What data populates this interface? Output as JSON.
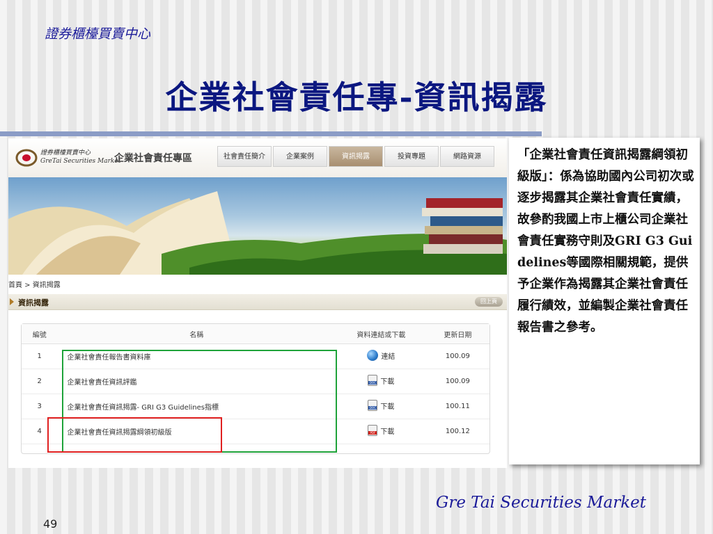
{
  "slide": {
    "org_name": "證券櫃檯買賣中心",
    "title": "企業社會責任專-資訊揭露",
    "footer_brand": "Gre Tai Securities Market",
    "page_number": "49",
    "note_text": "「企業社會責任資訊揭露綱領初級版」：係為協助國內公司初次或逐步揭露其企業社會責任實績，故參酌我國上市上櫃公司企業社會責任實務守則及GRI G3 Guidelines等國際相關規範，提供予企業作為揭露其企業社會責任履行績效，並編製企業社會責任報告書之參考。"
  },
  "site": {
    "logo_text_line1": "證券櫃檯買賣中心",
    "logo_text_line2": "GreTai Securities Market",
    "zone_title": "企業社會責任專區",
    "nav": [
      "社會責任簡介",
      "企業案例",
      "資訊揭露",
      "投資專題",
      "網路資源"
    ],
    "active_nav_index": 2,
    "breadcrumb": "首頁 > 資訊揭露",
    "section_title": "資訊揭露",
    "back_label": "回上頁",
    "table": {
      "headers": [
        "編號",
        "名稱",
        "資料連結或下載",
        "更新日期"
      ],
      "rows": [
        {
          "no": "1",
          "name": "企業社會責任報告書資料庫",
          "action": "連結",
          "icon": "globe-icon",
          "date": "100.09"
        },
        {
          "no": "2",
          "name": "企業社會責任資訊評鑑",
          "action": "下載",
          "icon": "doc-icon",
          "date": "100.09"
        },
        {
          "no": "3",
          "name": "企業社會責任資訊揭露- GRI G3 Guidelines指標",
          "action": "下載",
          "icon": "doc-icon",
          "date": "100.11"
        },
        {
          "no": "4",
          "name": "企業社會責任資訊揭露綱領初級版",
          "action": "下載",
          "icon": "pdf-icon",
          "date": "100.12"
        }
      ]
    }
  },
  "colors": {
    "title": "#0b1780",
    "highlight_green": "#1fa33a",
    "highlight_red": "#e02020"
  }
}
